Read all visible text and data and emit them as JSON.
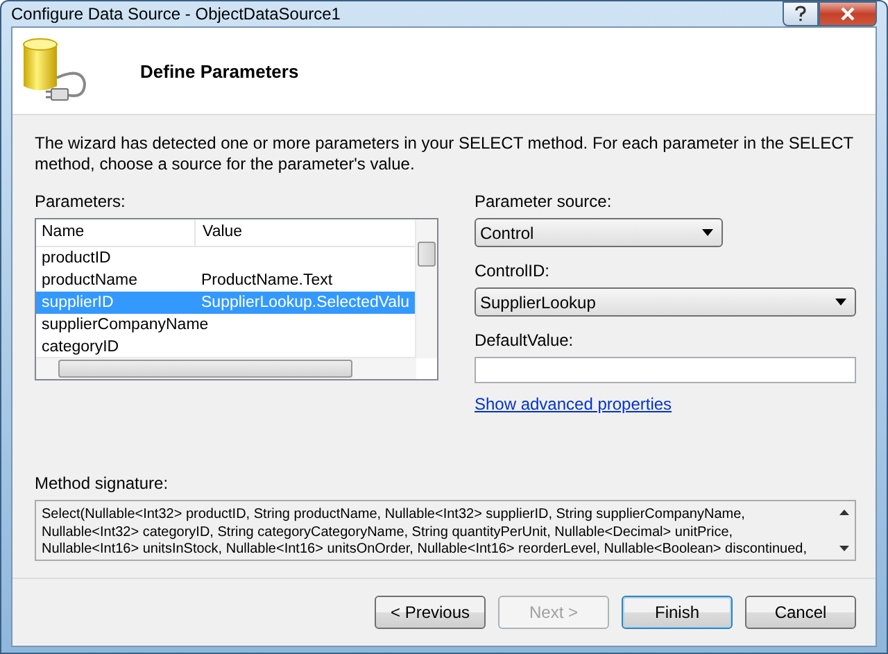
{
  "window": {
    "title": "Configure Data Source - ObjectDataSource1"
  },
  "header": {
    "title": "Define Parameters"
  },
  "description": "The wizard has detected one or more parameters in your SELECT method. For each parameter in the SELECT method, choose a source for the parameter's value.",
  "parameters": {
    "label": "Parameters:",
    "columns": [
      "Name",
      "Value"
    ],
    "rows": [
      {
        "name": "productID",
        "value": "",
        "selected": false
      },
      {
        "name": "productName",
        "value": "ProductName.Text",
        "selected": false
      },
      {
        "name": "supplierID",
        "value": "SupplierLookup.SelectedValu",
        "selected": true
      },
      {
        "name": "supplierCompanyName",
        "value": "",
        "selected": false
      },
      {
        "name": "categoryID",
        "value": "",
        "selected": false
      }
    ]
  },
  "parameter_source": {
    "label": "Parameter source:",
    "value": "Control"
  },
  "control_id": {
    "label": "ControlID:",
    "value": "SupplierLookup"
  },
  "default_value": {
    "label": "DefaultValue:"
  },
  "advanced_link": "Show advanced properties",
  "method_signature": {
    "label": "Method signature:",
    "lines": [
      "Select(Nullable<Int32> productID, String productName, Nullable<Int32> supplierID, String supplierCompanyName,",
      "Nullable<Int32> categoryID, String categoryCategoryName, String quantityPerUnit, Nullable<Decimal> unitPrice,",
      "Nullable<Int16> unitsInStock, Nullable<Int16> unitsOnOrder, Nullable<Int16> reorderLevel, Nullable<Boolean> discontinued,"
    ]
  },
  "buttons": [
    {
      "label": "< Previous",
      "disabled": false,
      "default": false
    },
    {
      "label": "Next >",
      "disabled": true,
      "default": false
    },
    {
      "label": "Finish",
      "disabled": false,
      "default": true
    },
    {
      "label": "Cancel",
      "disabled": false,
      "default": false
    }
  ]
}
